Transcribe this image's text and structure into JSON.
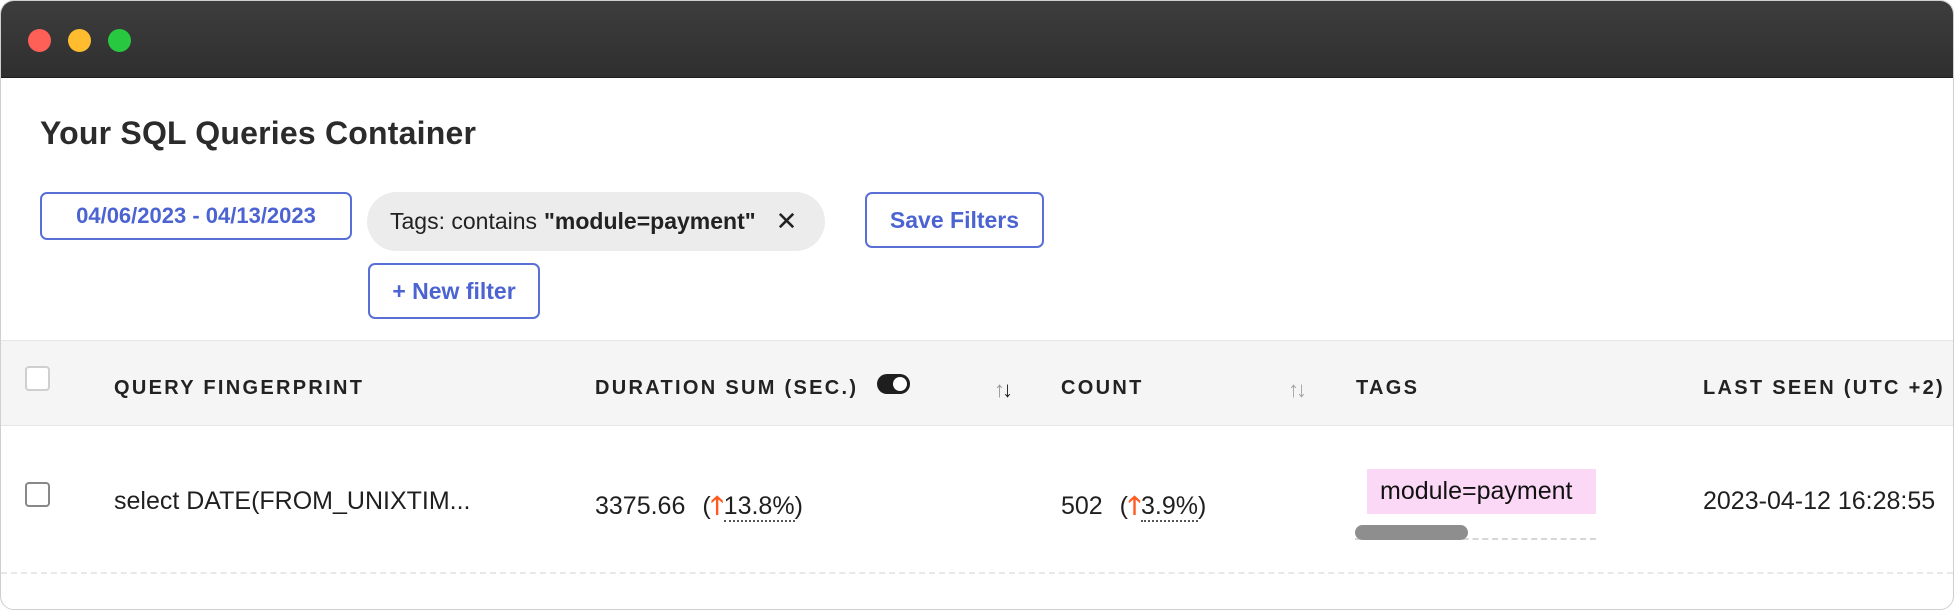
{
  "page": {
    "title": "Your SQL Queries Container"
  },
  "filters": {
    "date_range": "04/06/2023 - 04/13/2023",
    "chip_prefix": "Tags: contains",
    "chip_value": "\"module=payment\"",
    "chip_close": "✕",
    "save_label": "Save Filters",
    "new_filter_label": "+ New filter"
  },
  "table": {
    "columns": {
      "fingerprint": "QUERY FINGERPRINT",
      "duration": "DURATION SUM (SEC.)",
      "count": "COUNT",
      "tags": "TAGS",
      "last_seen": "LAST SEEN (UTC +2)"
    },
    "rows": [
      {
        "fingerprint": "select DATE(FROM_UNIXTIM...",
        "duration": "3375.66",
        "duration_trend": "13.8%",
        "count": "502",
        "count_trend": "3.9%",
        "tag": "module=payment",
        "last_seen": "2023-04-12 16:28:55"
      }
    ]
  },
  "colors": {
    "accent": "#4c63d2",
    "trend_up": "#ff5a1f",
    "tag_bg": "#fbd8f6",
    "titlebar": "#333333"
  },
  "icons": {
    "window_controls": [
      "close-dot",
      "minimize-dot",
      "maximize-dot"
    ],
    "trend": "arrow-up-icon",
    "sort": "sort-arrows-icon",
    "toggle": "toggle-icon"
  }
}
